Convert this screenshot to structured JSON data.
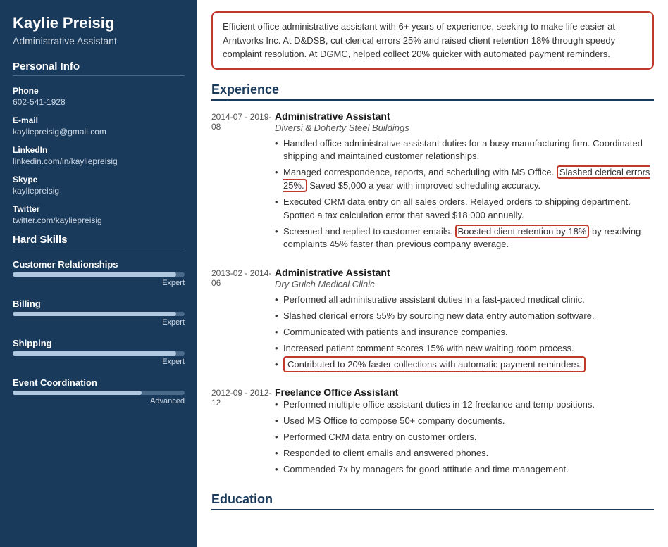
{
  "sidebar": {
    "name": "Kaylie Preisig",
    "title": "Administrative Assistant",
    "personal_info_heading": "Personal Info",
    "fields": [
      {
        "label": "Phone",
        "value": "602-541-1928"
      },
      {
        "label": "E-mail",
        "value": "kayliepreisig@gmail.com"
      },
      {
        "label": "LinkedIn",
        "value": "linkedin.com/in/kayliepreisig"
      },
      {
        "label": "Skype",
        "value": "kayliepreisig"
      },
      {
        "label": "Twitter",
        "value": "twitter.com/kayliepreisig"
      }
    ],
    "hard_skills_heading": "Hard Skills",
    "skills": [
      {
        "name": "Customer Relationships",
        "level": "Expert",
        "pct": 95
      },
      {
        "name": "Billing",
        "level": "Expert",
        "pct": 95
      },
      {
        "name": "Shipping",
        "level": "Expert",
        "pct": 95
      },
      {
        "name": "Event Coordination",
        "level": "Advanced",
        "pct": 75
      }
    ]
  },
  "summary": "Efficient office administrative assistant with 6+ years of experience, seeking to make life easier at Arntworks Inc. At D&DSB, cut clerical errors 25% and raised client retention 18% through speedy complaint resolution. At DGMC, helped collect 20% quicker with automated payment reminders.",
  "experience_heading": "Experience",
  "experience": [
    {
      "dates": "2014-07 - 2019-08",
      "title": "Administrative Assistant",
      "company": "Diversi & Doherty Steel Buildings",
      "bullets": [
        "Handled office administrative assistant duties for a busy manufacturing firm. Coordinated shipping and maintained customer relationships.",
        "Managed correspondence, reports, and scheduling with MS Office. Slashed clerical errors 25%. Saved $5,000 a year with improved scheduling accuracy.",
        "Executed CRM data entry on all sales orders. Relayed orders to shipping department. Spotted a tax calculation error that saved $18,000 annually.",
        "Screened and replied to customer emails. Boosted client retention by 18% by resolving complaints 45% faster than previous company average."
      ],
      "highlight_bullet2_parts": {
        "before": "Managed correspondence, reports, and scheduling with MS Office.",
        "highlight": "Slashed clerical errors 25%.",
        "after": "Saved $5,000 a year with improved scheduling accuracy."
      },
      "highlight_bullet4_parts": {
        "before": "Screened and replied to customer emails.",
        "highlight": "Boosted client retention by 18%",
        "after": "by resolving complaints 45% faster than previous company average."
      }
    },
    {
      "dates": "2013-02 - 2014-06",
      "title": "Administrative Assistant",
      "company": "Dry Gulch Medical Clinic",
      "bullets": [
        "Performed all administrative assistant duties in a fast-paced medical clinic.",
        "Slashed clerical errors 55% by sourcing new data entry automation software.",
        "Communicated with patients and insurance companies.",
        "Increased patient comment scores 15% with new waiting room process.",
        "Contributed to 20% faster collections with automatic payment reminders."
      ],
      "highlight_bullet5": "Contributed to 20% faster collections with automatic payment reminders."
    },
    {
      "dates": "2012-09 - 2012-12",
      "title": "Freelance Office Assistant",
      "company": "",
      "bullets": [
        "Performed multiple office assistant duties in 12 freelance and temp positions.",
        "Used MS Office to compose 50+ company documents.",
        "Performed CRM data entry on customer orders.",
        "Responded to client emails and answered phones.",
        "Commended 7x by managers for good attitude and time management."
      ]
    }
  ],
  "education_heading": "Education"
}
